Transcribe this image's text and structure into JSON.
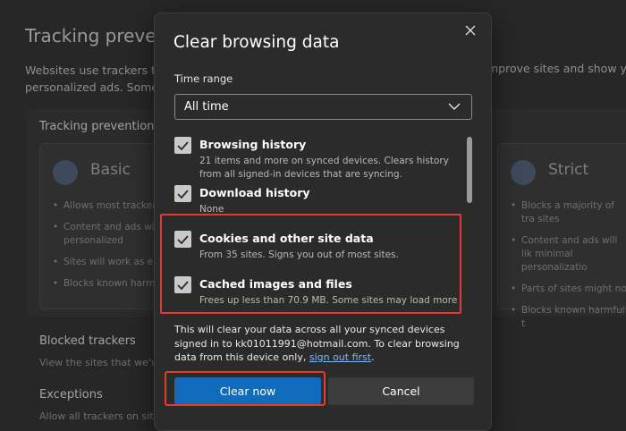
{
  "background": {
    "title": "Tracking prevent",
    "description_left": "Websites use trackers to",
    "description_left_2": "personalized ads. Some t",
    "description_right": "mprove sites and show yo",
    "card_title": "Tracking prevention",
    "basic": {
      "title": "Basic",
      "bullets": [
        "Allows most tracker",
        "Content and ads wi personalized",
        "Sites will work as e",
        "Blocks known harm"
      ]
    },
    "strict": {
      "title": "Strict",
      "bullets": [
        "Blocks a majority of tra sites",
        "Content and ads will lik minimal personalizatio",
        "Parts of sites might no",
        "Blocks known harmful t"
      ]
    },
    "blocked_trackers": "Blocked trackers",
    "blocked_trackers_sub": "View the sites that we've",
    "exceptions": "Exceptions",
    "exceptions_sub": "Allow all trackers on sites"
  },
  "dialog": {
    "title": "Clear browsing data",
    "time_range_label": "Time range",
    "time_range_value": "All time",
    "items": [
      {
        "label": "Browsing history",
        "desc": "21 items and more on synced devices. Clears history from all signed-in devices that are syncing.",
        "checked": true
      },
      {
        "label": "Download history",
        "desc": "None",
        "checked": true
      },
      {
        "label": "Cookies and other site data",
        "desc": "From 35 sites. Signs you out of most sites.",
        "checked": true
      },
      {
        "label": "Cached images and files",
        "desc": "Frees up less than 70.9 MB. Some sites may load more",
        "checked": true
      }
    ],
    "info_text": "This will clear your data across all your synced devices signed in to kk01011991@hotmail.com. To clear browsing data from this device only,",
    "info_link": "sign out first",
    "info_end": ".",
    "clear_button": "Clear now",
    "cancel_button": "Cancel"
  },
  "colors": {
    "accent": "#0f6cbd",
    "highlight": "#e53935",
    "link": "#8ab4f8"
  }
}
